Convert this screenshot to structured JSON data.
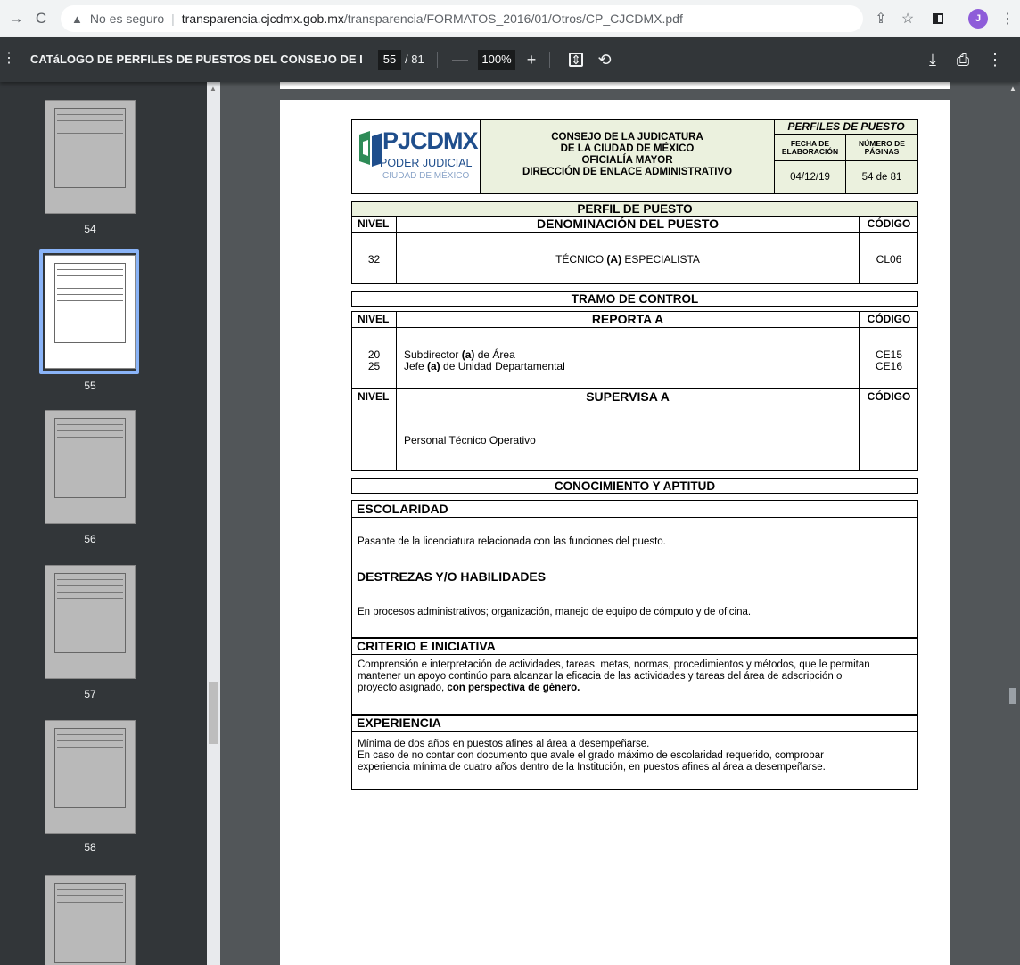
{
  "browser": {
    "security_label": "No es seguro",
    "url_host": "transparencia.cjcdmx.gob.mx",
    "url_path": "/transparencia/FORMATOS_2016/01/Otros/CP_CJCDMX.pdf",
    "profile_initial": "J"
  },
  "pdf_toolbar": {
    "title": "CATáLOGO DE PERFILES DE PUESTOS DEL CONSEJO DE LA JU...",
    "current_page": "55",
    "total_pages": "/ 81",
    "zoom": "100%"
  },
  "thumbnails": [
    {
      "number": "54"
    },
    {
      "number": "55"
    },
    {
      "number": "56"
    },
    {
      "number": "57"
    },
    {
      "number": "58"
    }
  ],
  "document": {
    "logo": {
      "line1": "PJCDMX",
      "line2": "PODER JUDICIAL",
      "line3": "CIUDAD DE MÉXICO"
    },
    "header": {
      "line1": "CONSEJO DE LA JUDICATURA",
      "line2": "DE LA CIUDAD DE MÉXICO",
      "line3": "OFICIALÍA MAYOR",
      "line4": "DIRECCIÓN DE ENLACE ADMINISTRATIVO",
      "perfiles": "PERFILES DE PUESTO",
      "fecha_label_1": "FECHA DE",
      "fecha_label_2": "ELABORACIÓN",
      "paginas_label_1": "NÚMERO DE",
      "paginas_label_2": "PÁGINAS",
      "fecha": "04/12/19",
      "paginas": "54 de 81"
    },
    "perfil_title": "PERFIL DE PUESTO",
    "nivel_label": "NIVEL",
    "codigo_label": "CÓDIGO",
    "denominacion_label": "DENOMINACIÓN DEL PUESTO",
    "puesto": {
      "nivel": "32",
      "name_pre": "TÉCNICO ",
      "name_bold": "(A)",
      "name_post": " ESPECIALISTA",
      "codigo": "CL06"
    },
    "tramo_title": "TRAMO DE CONTROL",
    "reporta_label": "REPORTA A",
    "reporta": [
      {
        "nivel": "20",
        "pre": "Subdirector ",
        "bold": "(a)",
        "post": " de Área",
        "codigo": "CE15"
      },
      {
        "nivel": "25",
        "pre": "Jefe ",
        "bold": "(a)",
        "post": " de Unidad Departamental",
        "codigo": "CE16"
      }
    ],
    "supervisa_label": "SUPERVISA A",
    "supervisa": "Personal Técnico Operativo",
    "conocimiento_title": "CONOCIMIENTO Y APTITUD",
    "escolaridad_title": "ESCOLARIDAD",
    "escolaridad": "Pasante de la licenciatura relacionada con las funciones del puesto.",
    "destrezas_title": "DESTREZAS Y/O HABILIDADES",
    "destrezas": "En procesos administrativos; organización, manejo de equipo de cómputo y de oficina.",
    "criterio_title": "CRITERIO E INICIATIVA",
    "criterio_1": "Comprensión e interpretación de actividades, tareas, metas, normas, procedimientos y métodos, que le permitan",
    "criterio_2": "mantener un apoyo continúo para alcanzar la eficacia de las actividades y tareas del área de adscripción o",
    "criterio_3_pre": "proyecto asignado, ",
    "criterio_3_bold": "con perspectiva de género.",
    "experiencia_title": "EXPERIENCIA",
    "experiencia_1": "Mínima de dos años en puestos afines al área a desempeñarse.",
    "experiencia_2": "En caso de no contar con documento que avale el grado máximo de escolaridad requerido, comprobar",
    "experiencia_3": "experiencia mínima de cuatro años dentro de la Institución, en puestos afines al área a desempeñarse."
  }
}
